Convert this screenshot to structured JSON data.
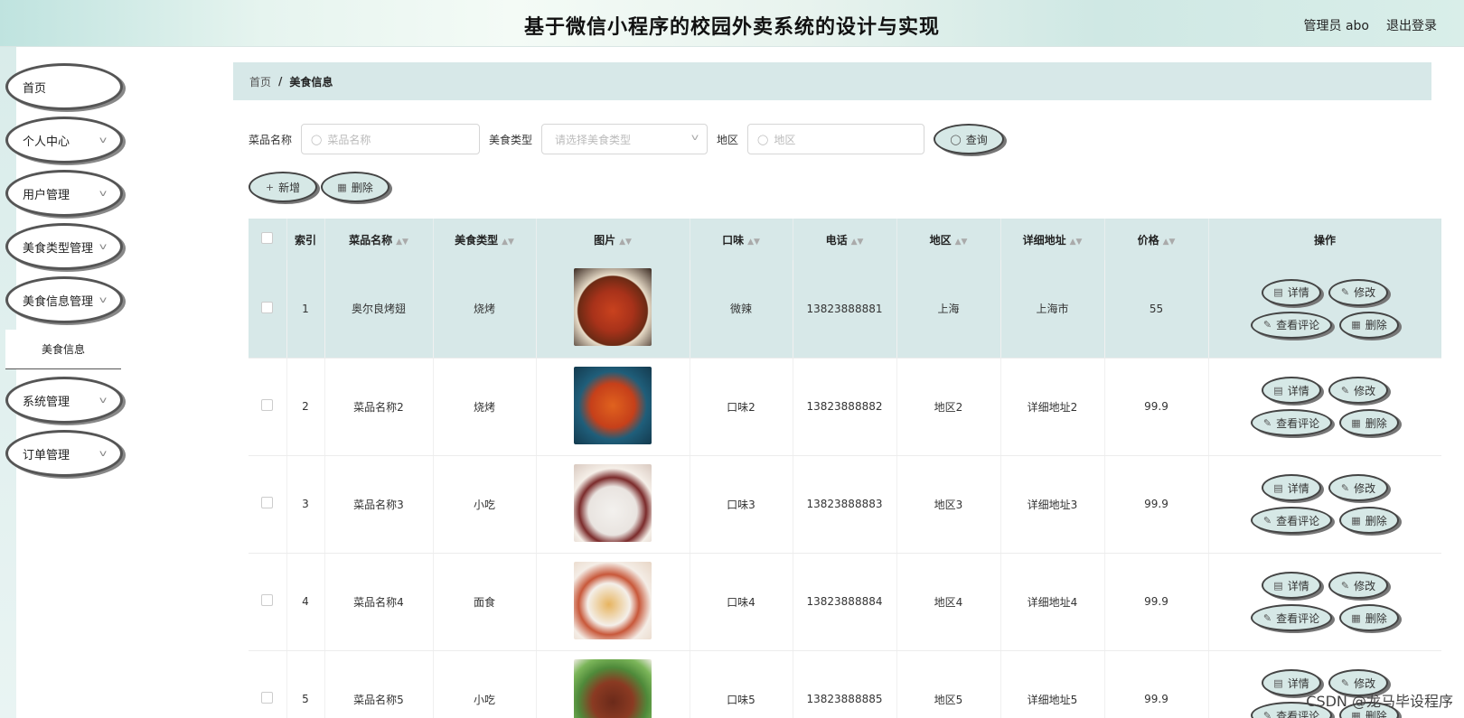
{
  "header": {
    "title": "基于微信小程序的校园外卖系统的设计与实现",
    "admin": "管理员 abo",
    "logout": "退出登录"
  },
  "sidebar": {
    "items": [
      {
        "label": "首页",
        "chevron": false
      },
      {
        "label": "个人中心",
        "chevron": true
      },
      {
        "label": "用户管理",
        "chevron": true
      },
      {
        "label": "美食类型管理",
        "chevron": true
      },
      {
        "label": "美食信息管理",
        "chevron": true
      },
      {
        "label": "系统管理",
        "chevron": true
      },
      {
        "label": "订单管理",
        "chevron": true
      }
    ],
    "submenu_active": "美食信息"
  },
  "breadcrumb": {
    "home": "首页",
    "separator": "/",
    "current": "美食信息"
  },
  "search": {
    "name_label": "菜品名称",
    "name_placeholder": "菜品名称",
    "type_label": "美食类型",
    "type_placeholder": "请选择美食类型",
    "region_label": "地区",
    "region_placeholder": "地区",
    "query_button": "查询"
  },
  "toolbar": {
    "add": "新增",
    "delete": "删除"
  },
  "table": {
    "headers": [
      "索引",
      "菜品名称",
      "美食类型",
      "图片",
      "口味",
      "电话",
      "地区",
      "详细地址",
      "价格",
      "操作"
    ],
    "rows": [
      {
        "index": "1",
        "name": "奥尔良烤翅",
        "type": "烧烤",
        "taste": "微辣",
        "phone": "13823888881",
        "region": "上海",
        "address": "上海市",
        "price": "55",
        "highlight": true
      },
      {
        "index": "2",
        "name": "菜品名称2",
        "type": "烧烤",
        "taste": "口味2",
        "phone": "13823888882",
        "region": "地区2",
        "address": "详细地址2",
        "price": "99.9",
        "highlight": false
      },
      {
        "index": "3",
        "name": "菜品名称3",
        "type": "小吃",
        "taste": "口味3",
        "phone": "13823888883",
        "region": "地区3",
        "address": "详细地址3",
        "price": "99.9",
        "highlight": false
      },
      {
        "index": "4",
        "name": "菜品名称4",
        "type": "面食",
        "taste": "口味4",
        "phone": "13823888884",
        "region": "地区4",
        "address": "详细地址4",
        "price": "99.9",
        "highlight": false
      },
      {
        "index": "5",
        "name": "菜品名称5",
        "type": "小吃",
        "taste": "口味5",
        "phone": "13823888885",
        "region": "地区5",
        "address": "详细地址5",
        "price": "99.9",
        "highlight": false
      }
    ],
    "actions": {
      "detail": "详情",
      "edit": "修改",
      "comments": "查看评论",
      "delete": "删除"
    }
  },
  "watermark": "CSDN @龙马毕设程序",
  "colors": {
    "accent": "#d7e8e8",
    "border": "#444444"
  }
}
